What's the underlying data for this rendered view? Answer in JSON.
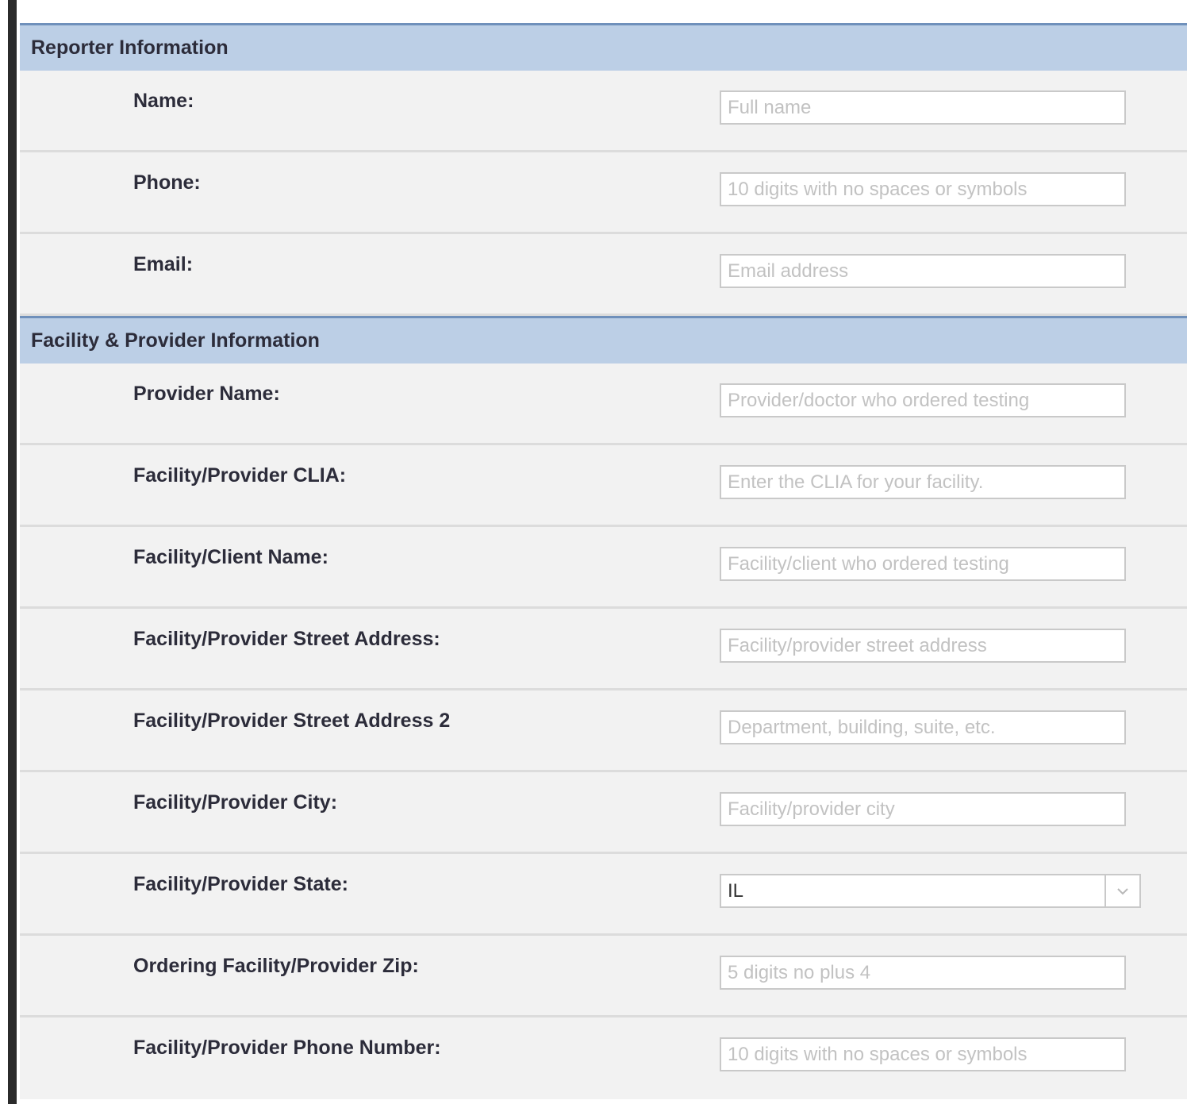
{
  "sections": [
    {
      "title": "Reporter Information",
      "fields": [
        {
          "label": "Name:",
          "placeholder": "Full name"
        },
        {
          "label": "Phone:",
          "placeholder": "10 digits with no spaces or symbols"
        },
        {
          "label": "Email:",
          "placeholder": "Email address"
        }
      ]
    },
    {
      "title": "Facility & Provider Information",
      "fields": [
        {
          "label": "Provider Name:",
          "placeholder": "Provider/doctor who ordered testing"
        },
        {
          "label": "Facility/Provider CLIA:",
          "placeholder": "Enter the CLIA for your facility."
        },
        {
          "label": "Facility/Client Name:",
          "placeholder": "Facility/client who ordered testing"
        },
        {
          "label": "Facility/Provider Street Address:",
          "placeholder": "Facility/provider street address"
        },
        {
          "label": "Facility/Provider Street Address 2",
          "placeholder": "Department, building, suite, etc."
        },
        {
          "label": "Facility/Provider City:",
          "placeholder": "Facility/provider city"
        },
        {
          "label": "Facility/Provider State:",
          "value": "IL",
          "icon": "chevron-down-icon"
        },
        {
          "label": "Ordering Facility/Provider Zip:",
          "placeholder": "5 digits no plus 4"
        },
        {
          "label": "Facility/Provider Phone Number:",
          "placeholder": "10 digits with no spaces or symbols"
        }
      ]
    }
  ]
}
